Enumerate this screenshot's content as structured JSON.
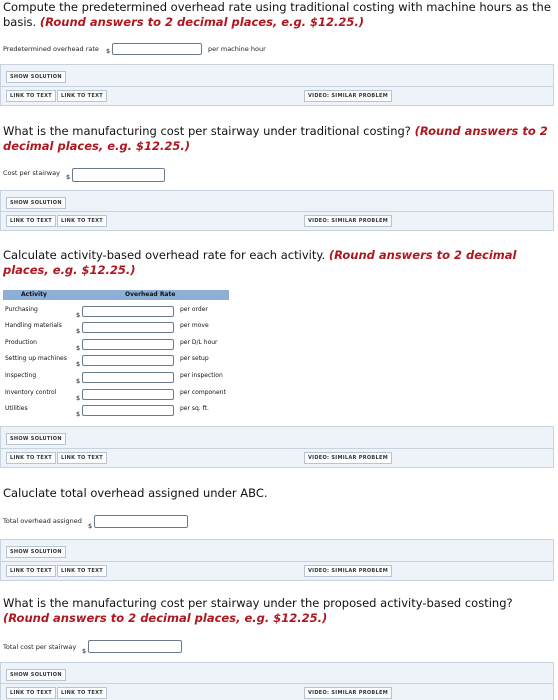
{
  "q1": {
    "text": "Compute the predetermined overhead rate using traditional costing with machine hours as the basis.",
    "hint": "(Round answers to 2 decimal places, e.g. $12.25.)"
  },
  "q1_field": {
    "label": "Predetermined overhead rate",
    "currency": "$",
    "unit": "per machine hour"
  },
  "buttons": {
    "show_solution": "SHOW SOLUTION",
    "link_text": "LINK TO TEXT",
    "video": "VIDEO: SIMILAR PROBLEM"
  },
  "q2": {
    "text": "What is the manufacturing cost per stairway under traditional costing?",
    "hint": "(Round answers to 2 decimal places, e.g. $12.25.)"
  },
  "q2_field": {
    "label": "Cost per stairway",
    "currency": "$"
  },
  "q3": {
    "text": "Calculate activity-based overhead rate for each activity.",
    "hint": "(Round answers to 2 decimal places, e.g. $12.25.)"
  },
  "q3_table": {
    "headers": [
      "Activity",
      "Overhead Rate"
    ],
    "currency": "$",
    "rows": [
      {
        "activity": "Purchasing",
        "unit": "per order"
      },
      {
        "activity": "Handling materials",
        "unit": "per move"
      },
      {
        "activity": "Production",
        "unit": "per D/L hour"
      },
      {
        "activity": "Setting up machines",
        "unit": "per setup"
      },
      {
        "activity": "Inspecting",
        "unit": "per inspection"
      },
      {
        "activity": "Inventory control",
        "unit": "per component"
      },
      {
        "activity": "Utilities",
        "unit": "per sq. ft."
      }
    ]
  },
  "q4": {
    "text": "Caluclate total overhead assigned under ABC."
  },
  "q4_field": {
    "label": "Total overhead assigned",
    "currency": "$"
  },
  "q5": {
    "text": "What is the manufacturing cost per stairway under the proposed activity-based costing?",
    "hint": "(Round answers to 2 decimal places, e.g. $12.25.)"
  },
  "q5_field": {
    "label": "Total cost per stairway",
    "currency": "$"
  },
  "colors": {
    "hint": "#b0171f",
    "panel": "#eef3f9",
    "table_header": "#8fb0d6"
  }
}
